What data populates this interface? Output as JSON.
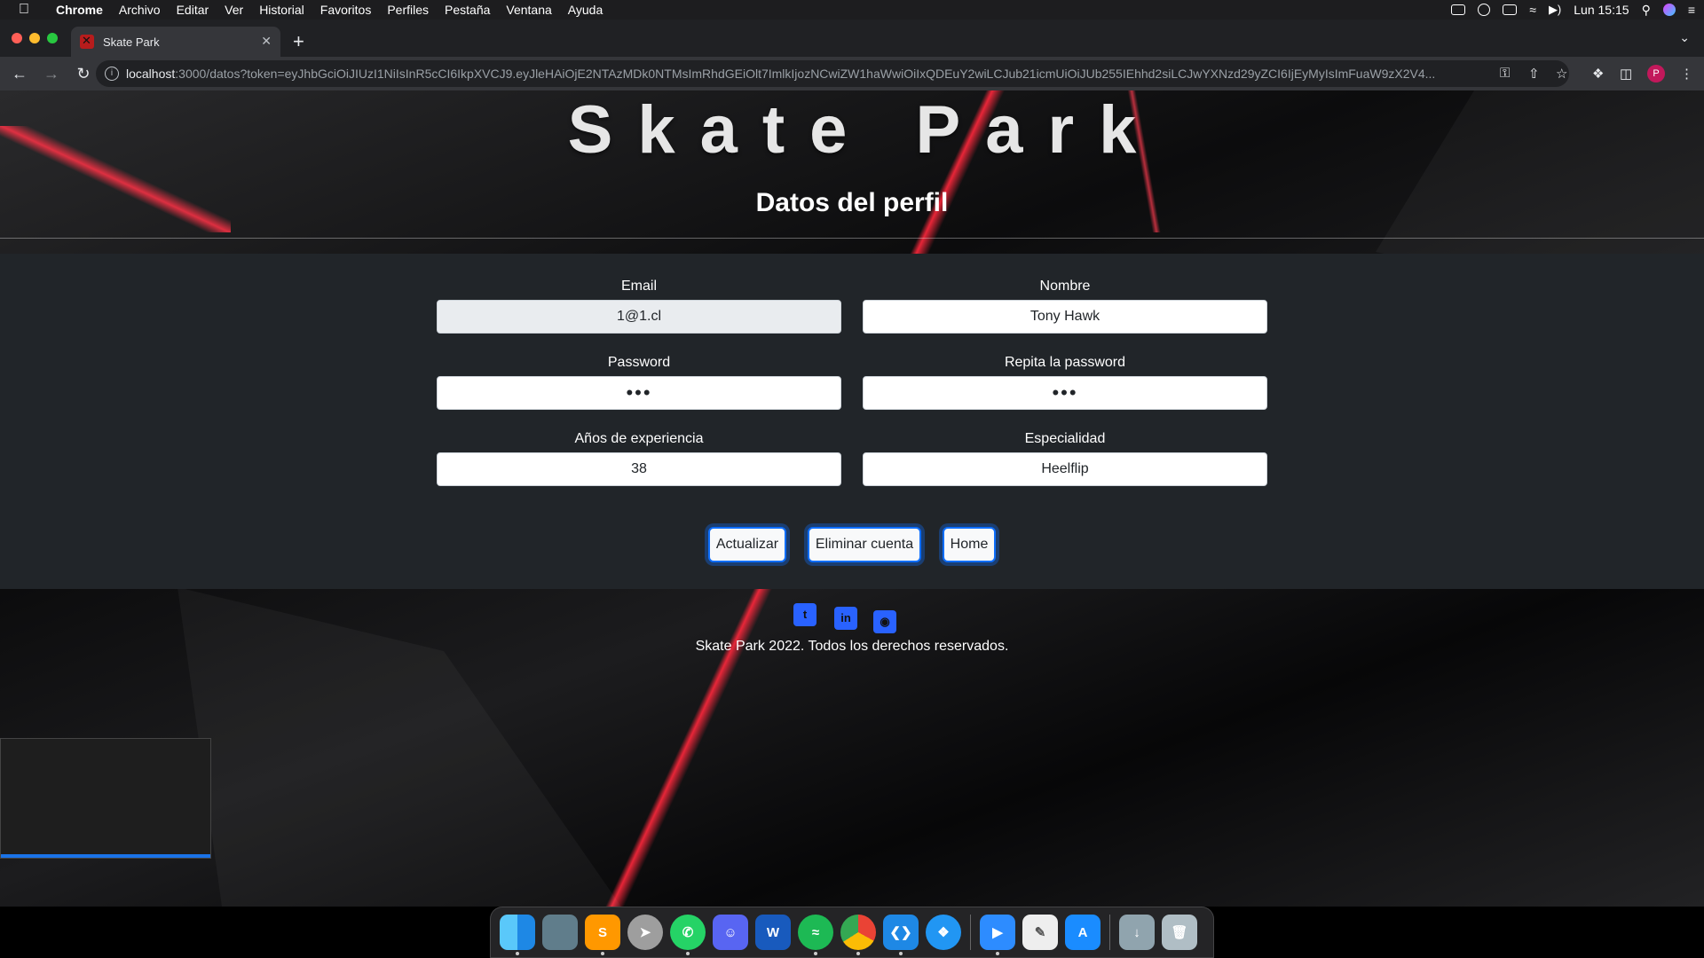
{
  "menubar": {
    "app": "Chrome",
    "items": [
      "Archivo",
      "Editar",
      "Ver",
      "Historial",
      "Favoritos",
      "Perfiles",
      "Pestaña",
      "Ventana",
      "Ayuda"
    ],
    "clock": "Lun 15:15"
  },
  "browser": {
    "tab_title": "Skate Park",
    "url_host": "localhost",
    "url_path": ":3000/datos?token=eyJhbGciOiJIUzI1NiIsInR5cCI6IkpXVCJ9.eyJleHAiOjE2NTAzMDk0NTMsImRhdGEiOlt7ImlkIjozNCwiZW1haWwiOiIxQDEuY2wiLCJub21icmUiOiJUb255IEhhd2siLCJwYXNzd29yZCI6IjEyMyIsImFuaW9zX2V4...",
    "avatar_letter": "P"
  },
  "page": {
    "brand": "Skate Park",
    "subtitle": "Datos del perfil",
    "form": {
      "email_label": "Email",
      "email_value": "1@1.cl",
      "nombre_label": "Nombre",
      "nombre_value": "Tony Hawk",
      "password_label": "Password",
      "password_value": "123",
      "repeat_label": "Repita la password",
      "repeat_value": "123",
      "anios_label": "Años de experiencia",
      "anios_value": "38",
      "especialidad_label": "Especialidad",
      "especialidad_value": "Heelflip"
    },
    "buttons": {
      "actualizar": "Actualizar",
      "eliminar": "Eliminar cuenta",
      "home": "Home"
    },
    "footer": {
      "copyright": "Skate Park 2022. Todos los derechos reservados.",
      "social_icons": [
        "twitter-icon",
        "linkedin-icon",
        "github-icon"
      ]
    }
  },
  "dock": {
    "apps": [
      "Finder",
      "Preview",
      "Sublime Text",
      "Launchpad",
      "WhatsApp",
      "Discord",
      "Word",
      "Spotify",
      "Chrome",
      "VS Code",
      "Safari",
      "Zoom",
      "TextEdit",
      "App Store",
      "Downloads",
      "Trash"
    ]
  }
}
